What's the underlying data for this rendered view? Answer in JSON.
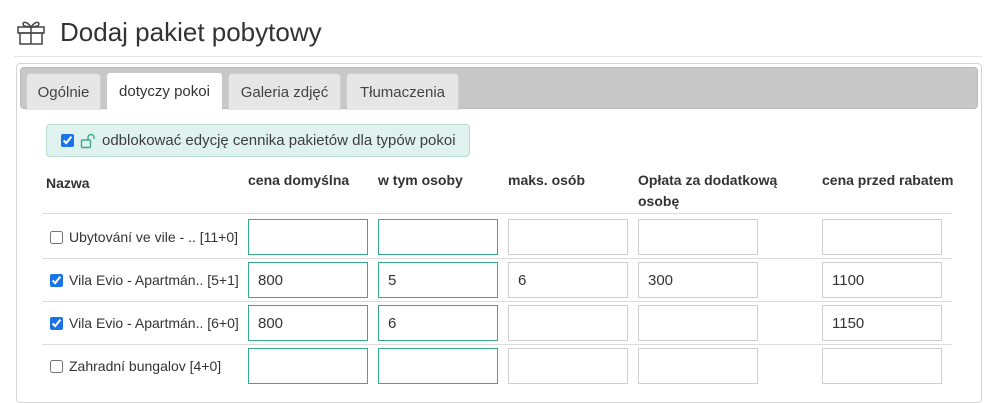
{
  "page": {
    "title": "Dodaj pakiet pobytowy"
  },
  "tabs": [
    {
      "label": "Ogólnie",
      "active": false
    },
    {
      "label": "dotyczy pokoi",
      "active": true
    },
    {
      "label": "Galeria zdjęć",
      "active": false
    },
    {
      "label": "Tłumaczenia",
      "active": false
    }
  ],
  "notice": {
    "label": "odblokować edycję cennika pakietów dla typów pokoi",
    "checked": true
  },
  "table": {
    "headers": {
      "name": "Nazwa",
      "default_price": "cena domyślna",
      "incl_persons": "w tym osoby",
      "max_persons": "maks. osób",
      "extra_fee": "Opłata za dodatkową",
      "extra_fee_2": "osobę",
      "pre_discount": "cena przed rabatem"
    },
    "rows": [
      {
        "label": "Ubytování ve vile - .. [11+0]",
        "checked": false,
        "default_price": "",
        "incl_persons": "",
        "max_persons": "",
        "extra_fee": "",
        "pre_discount": ""
      },
      {
        "label": "Vila Evio - Apartmán.. [5+1]",
        "checked": true,
        "default_price": "800",
        "incl_persons": "5",
        "max_persons": "6",
        "extra_fee": "300",
        "pre_discount": "1100"
      },
      {
        "label": "Vila Evio - Apartmán.. [6+0]",
        "checked": true,
        "default_price": "800",
        "incl_persons": "6",
        "max_persons": "",
        "extra_fee": "",
        "pre_discount": "1150"
      },
      {
        "label": "Zahradní bungalov [4+0]",
        "checked": false,
        "default_price": "",
        "incl_persons": "",
        "max_persons": "",
        "extra_fee": "",
        "pre_discount": ""
      }
    ]
  },
  "colors": {
    "accent": "#39a98c",
    "notice_bg": "#e0f2ee",
    "tabbar_bg": "#c8c8c8"
  },
  "icons": {
    "header": "gift-box-icon",
    "notice": "unlock-icon"
  }
}
